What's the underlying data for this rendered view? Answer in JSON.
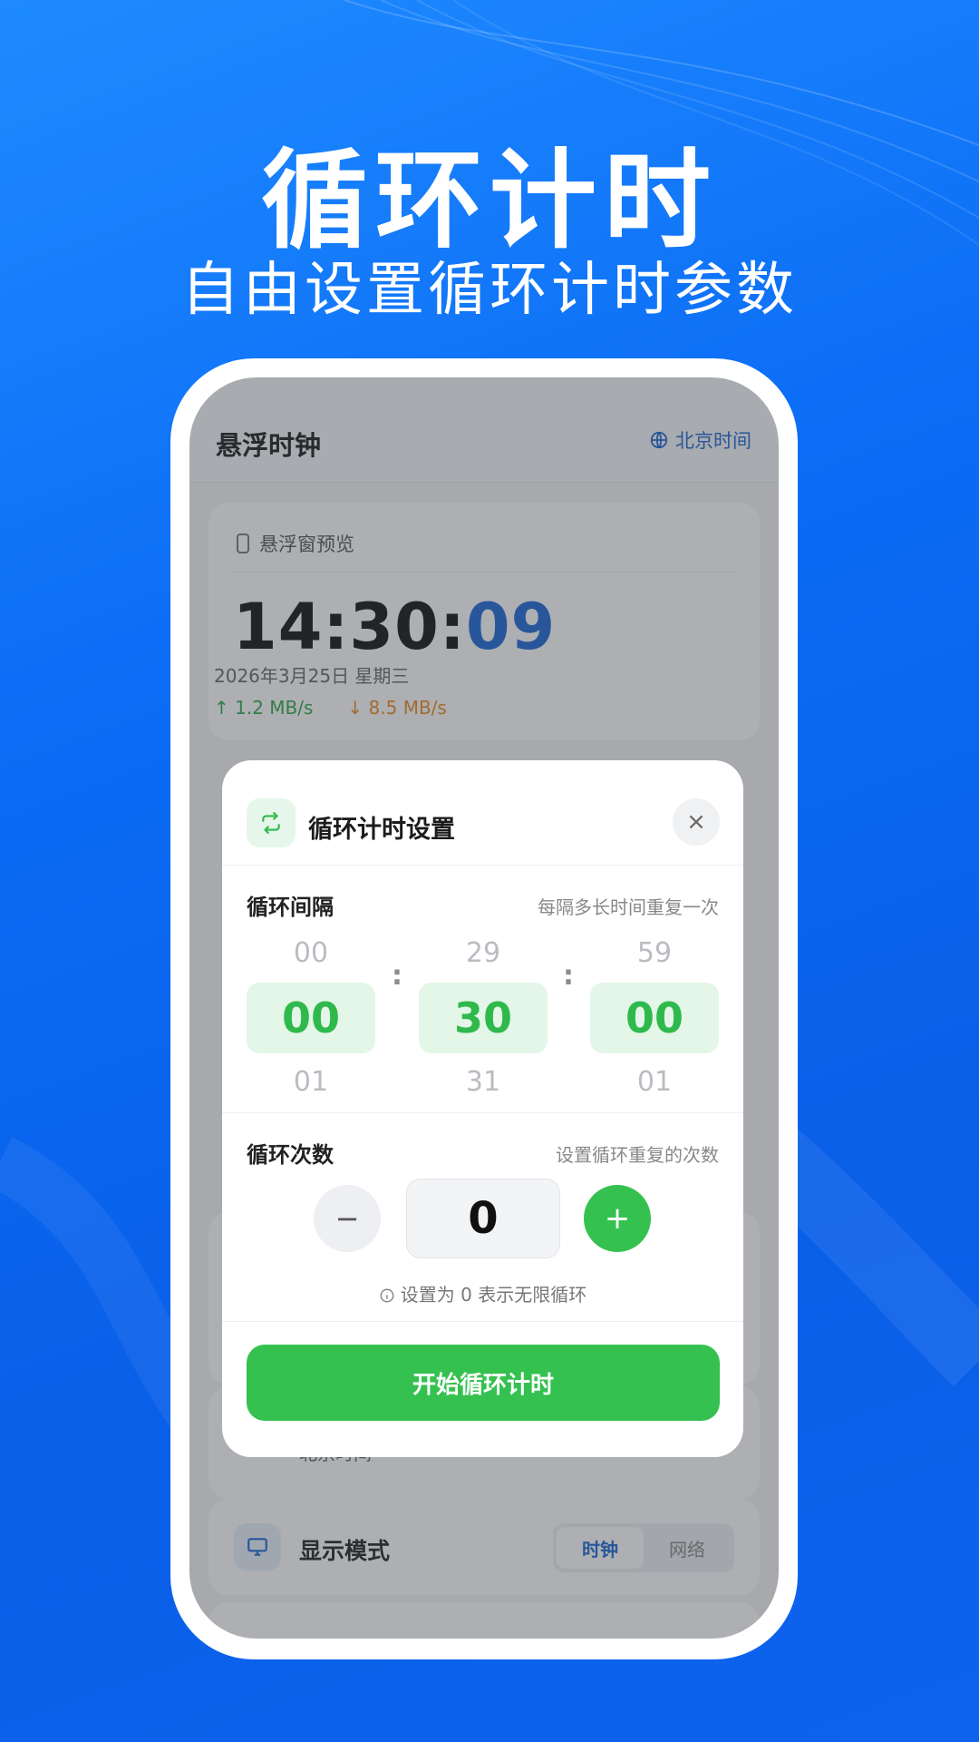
{
  "hero": {
    "title": "循环计时",
    "subtitle": "自由设置循环计时参数"
  },
  "app": {
    "title": "悬浮时钟",
    "header_link": "北京时间",
    "header_link_icon": "globe-icon"
  },
  "preview": {
    "label": "悬浮窗预览",
    "icon": "phone-icon",
    "time_hm": "14:30:",
    "time_sec": "09",
    "date": "2026年3月25日 星期三",
    "upload": "↑ 1.2 MB/s",
    "download": "↓ 8.5 MB/s"
  },
  "background_rows": {
    "partial_text": "北京时间",
    "display_mode": {
      "label": "显示模式",
      "icon": "monitor-icon",
      "options": [
        "时钟",
        "网络"
      ],
      "selected": "时钟"
    }
  },
  "modal": {
    "title": "循环计时设置",
    "icon": "repeat-icon",
    "close_label": "×",
    "interval": {
      "label": "循环间隔",
      "hint": "每隔多长时间重复一次",
      "hours": {
        "prev": "00",
        "value": "00",
        "next": "01"
      },
      "minutes": {
        "prev": "29",
        "value": "30",
        "next": "31"
      },
      "seconds": {
        "prev": "59",
        "value": "00",
        "next": "01"
      },
      "separator": ":"
    },
    "count": {
      "label": "循环次数",
      "hint": "设置循环重复的次数",
      "minus_label": "−",
      "value": "0",
      "plus_label": "+",
      "tip": "设置为 0 表示无限循环"
    },
    "start_button": "开始循环计时"
  },
  "colors": {
    "accent_green": "#35c150",
    "accent_blue": "#1a66d6",
    "background_blue": "#0b6cf5"
  }
}
